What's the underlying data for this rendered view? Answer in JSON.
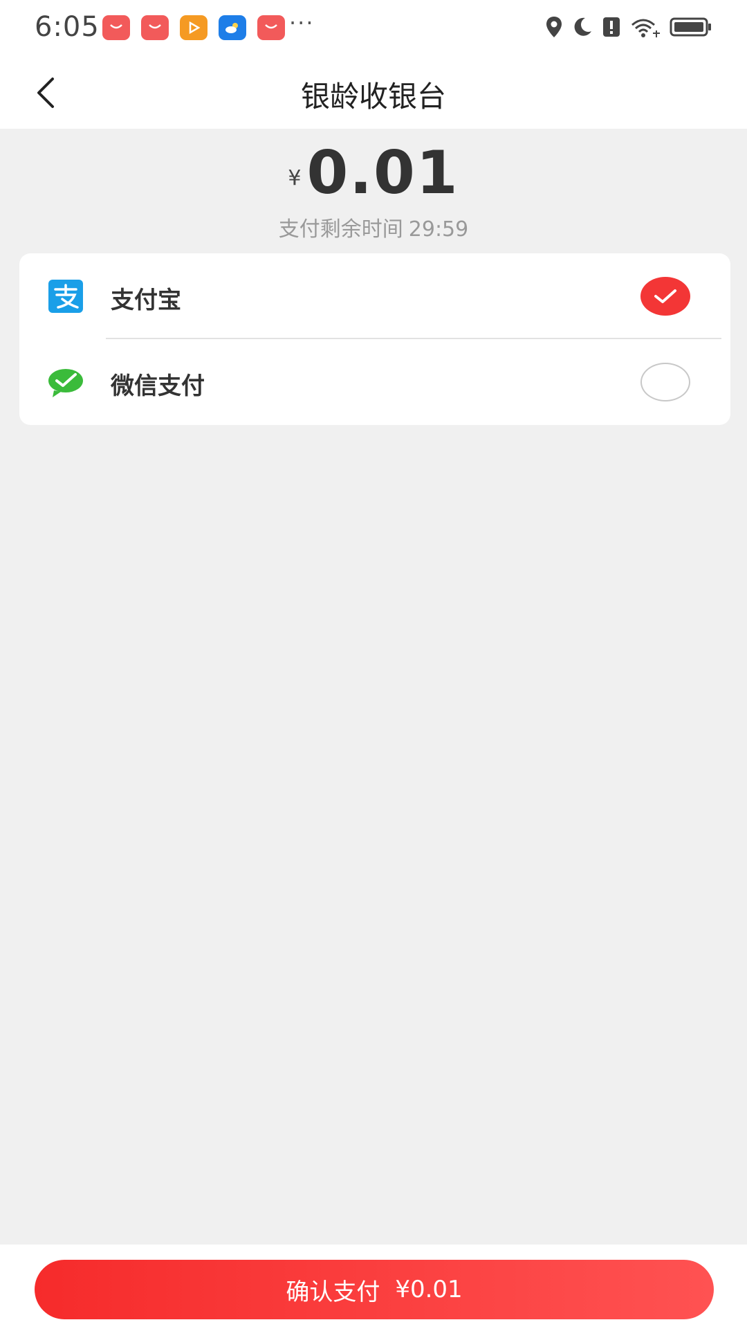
{
  "status_bar": {
    "time": "6:05",
    "more": "···",
    "notification_icons": [
      "shopping-bag-icon",
      "shopping-bag-icon",
      "video-play-icon",
      "weather-icon",
      "shopping-bag-icon"
    ],
    "system_icons": [
      "location-icon",
      "moon-icon",
      "alert-icon",
      "wifi-icon",
      "battery-icon"
    ]
  },
  "nav": {
    "title": "银龄收银台"
  },
  "order": {
    "currency_symbol": "¥",
    "amount": "0.01",
    "countdown_label": "支付剩余时间",
    "countdown_value": "29:59"
  },
  "payment_methods": [
    {
      "label": "支付宝",
      "icon": "alipay-icon",
      "selected": true
    },
    {
      "label": "微信支付",
      "icon": "wechat-pay-icon",
      "selected": false
    }
  ],
  "bottom": {
    "confirm_label": "确认支付",
    "confirm_amount": "¥0.01"
  },
  "colors": {
    "accent": "#f33636",
    "alipay": "#1a9fe8",
    "wechat": "#3bbb3b",
    "background": "#f0f0f0"
  }
}
